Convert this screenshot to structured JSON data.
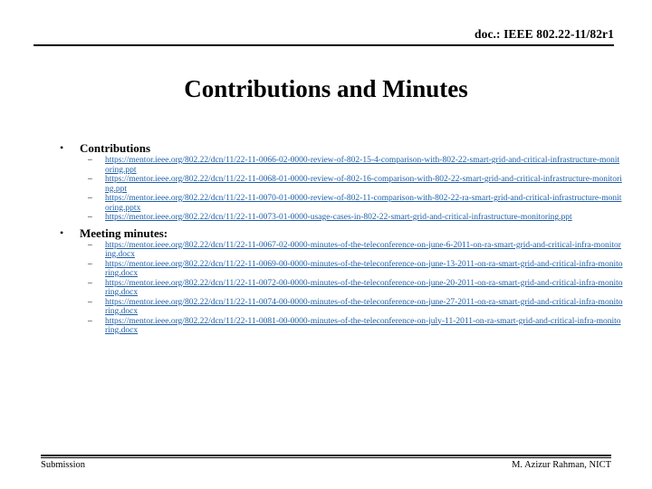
{
  "header": {
    "doc_label": "doc.: IEEE 802.22-11/82r1"
  },
  "title": "Contributions and Minutes",
  "sections": [
    {
      "bullet": "•",
      "heading": "Contributions",
      "items": [
        {
          "dash": "–",
          "url": "https://mentor.ieee.org/802.22/dcn/11/22-11-0066-02-0000-review-of-802-15-4-comparison-with-802-22-smart-grid-and-critical-infrastructure-monitoring.ppt"
        },
        {
          "dash": "–",
          "url": "https://mentor.ieee.org/802.22/dcn/11/22-11-0068-01-0000-review-of-802-16-comparison-with-802-22-smart-grid-and-critical-infrastructure-monitoring.ppt"
        },
        {
          "dash": "–",
          "url": "https://mentor.ieee.org/802.22/dcn/11/22-11-0070-01-0000-review-of-802-11-comparison-with-802-22-ra-smart-grid-and-critical-infrastructure-monitoring.pptx"
        },
        {
          "dash": "–",
          "url": "https://mentor.ieee.org/802.22/dcn/11/22-11-0073-01-0000-usage-cases-in-802-22-smart-grid-and-critical-infrastructure-monitoring.ppt"
        }
      ]
    },
    {
      "bullet": "•",
      "heading": "Meeting minutes:",
      "items": [
        {
          "dash": "–",
          "url": "https://mentor.ieee.org/802.22/dcn/11/22-11-0067-02-0000-minutes-of-the-teleconference-on-june-6-2011-on-ra-smart-grid-and-critical-infra-monitoring.docx"
        },
        {
          "dash": "–",
          "url": "https://mentor.ieee.org/802.22/dcn/11/22-11-0069-00-0000-minutes-of-the-teleconference-on-june-13-2011-on-ra-smart-grid-and-critical-infra-monitoring.docx"
        },
        {
          "dash": "–",
          "url": "https://mentor.ieee.org/802.22/dcn/11/22-11-0072-00-0000-minutes-of-the-teleconference-on-june-20-2011-on-ra-smart-grid-and-critical-infra-monitoring.docx"
        },
        {
          "dash": "–",
          "url": "https://mentor.ieee.org/802.22/dcn/11/22-11-0074-00-0000-minutes-of-the-teleconference-on-june-27-2011-on-ra-smart-grid-and-critical-infra-monitoring.docx"
        },
        {
          "dash": "–",
          "url": "https://mentor.ieee.org/802.22/dcn/11/22-11-0081-00-0000-minutes-of-the-teleconference-on-july-11-2011-on-ra-smart-grid-and-critical-infra-monitoring.docx"
        }
      ]
    }
  ],
  "footer": {
    "left": "Submission",
    "right": "M. Azizur Rahman, NICT"
  },
  "colors": {
    "link": "#1f5fa8",
    "text": "#000000",
    "background": "#ffffff"
  }
}
